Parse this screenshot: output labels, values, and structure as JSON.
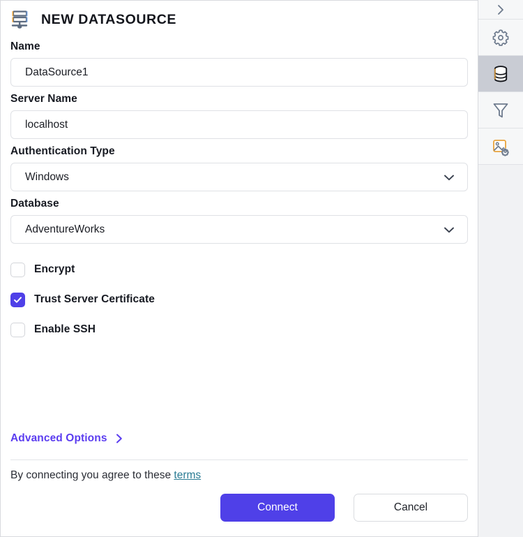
{
  "header": {
    "title": "NEW DATASOURCE",
    "icon": "datasource-stack-icon"
  },
  "form": {
    "fields": [
      {
        "label": "Name",
        "type": "text",
        "value": "DataSource1",
        "placeholder": "Name",
        "name": "name"
      },
      {
        "label": "Server Name",
        "type": "text",
        "value": "localhost",
        "placeholder": "Server Name",
        "name": "server-name"
      },
      {
        "label": "Authentication Type",
        "type": "select",
        "value": "Windows",
        "placeholder": "Authentication Type",
        "name": "authentication-type"
      },
      {
        "label": "Database",
        "type": "select",
        "value": "AdventureWorks",
        "placeholder": "Database",
        "name": "database"
      }
    ],
    "checkboxes": [
      {
        "label": "Encrypt",
        "checked": false,
        "name": "encrypt"
      },
      {
        "label": "Trust Server Certificate",
        "checked": true,
        "name": "trust-server-certificate"
      },
      {
        "label": "Enable SSH",
        "checked": false,
        "name": "enable-ssh"
      }
    ]
  },
  "advanced": {
    "label": "Advanced Options",
    "icon": "chevron-right-icon"
  },
  "terms": {
    "text": "By connecting you agree to these ",
    "link_label": "terms"
  },
  "actions": {
    "connect_label": "Connect",
    "cancel_label": "Cancel"
  },
  "sidebar": {
    "items": [
      {
        "icon": "chevron-right-icon",
        "name": "expand-panel",
        "selected": false
      },
      {
        "icon": "gear-icon",
        "name": "settings",
        "selected": false
      },
      {
        "icon": "database-icon",
        "name": "datasource",
        "selected": true
      },
      {
        "icon": "filter-icon",
        "name": "filter",
        "selected": false
      },
      {
        "icon": "image-settings-icon",
        "name": "image-settings",
        "selected": false
      }
    ]
  },
  "colors": {
    "accent": "#4f40e8",
    "link": "#5b3df0",
    "terms_link": "#2a7b93",
    "sidebar_bg": "#f1f2f4",
    "selected_bg": "#c9ccd4",
    "icon_stroke": "#5c6b80",
    "icon_accent": "#e8a33d"
  }
}
